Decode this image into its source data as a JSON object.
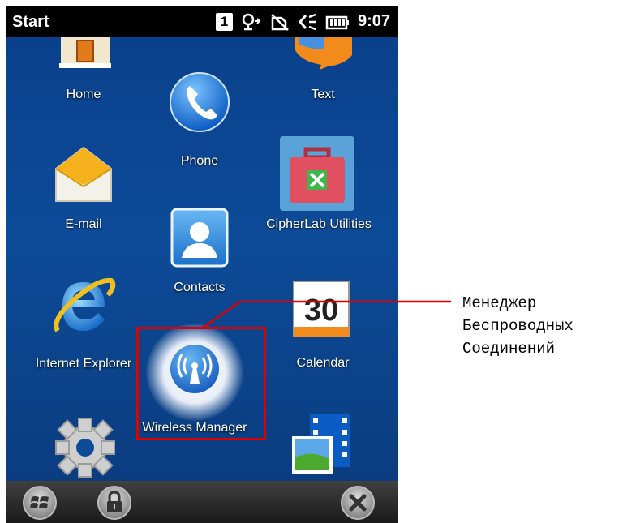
{
  "status_bar": {
    "title": "Start",
    "notification_badge": "1",
    "time": "9:07"
  },
  "tiles": [
    {
      "label": "Home",
      "icon": "house-icon"
    },
    {
      "label": "Phone",
      "icon": "phone-handset-icon"
    },
    {
      "label": "Text",
      "icon": "speech-bubble-icon"
    },
    {
      "label": "E-mail",
      "icon": "envelope-icon"
    },
    {
      "label": "CipherLab Utilities",
      "icon": "toolbox-icon"
    },
    {
      "label": "Contacts",
      "icon": "contact-card-icon"
    },
    {
      "label": "Internet Explorer",
      "icon": "internet-explorer-icon"
    },
    {
      "label": "Calendar",
      "icon": "calendar-icon",
      "day": "30"
    },
    {
      "label": "Wireless Manager",
      "icon": "wireless-manager-icon"
    }
  ],
  "annotation": {
    "lines": [
      "Менеджер",
      "Беспроводных",
      "Соединений"
    ],
    "color": "#e00000"
  },
  "taskbar": {
    "buttons": [
      "windows-start-icon",
      "lock-icon",
      "close-icon"
    ]
  }
}
